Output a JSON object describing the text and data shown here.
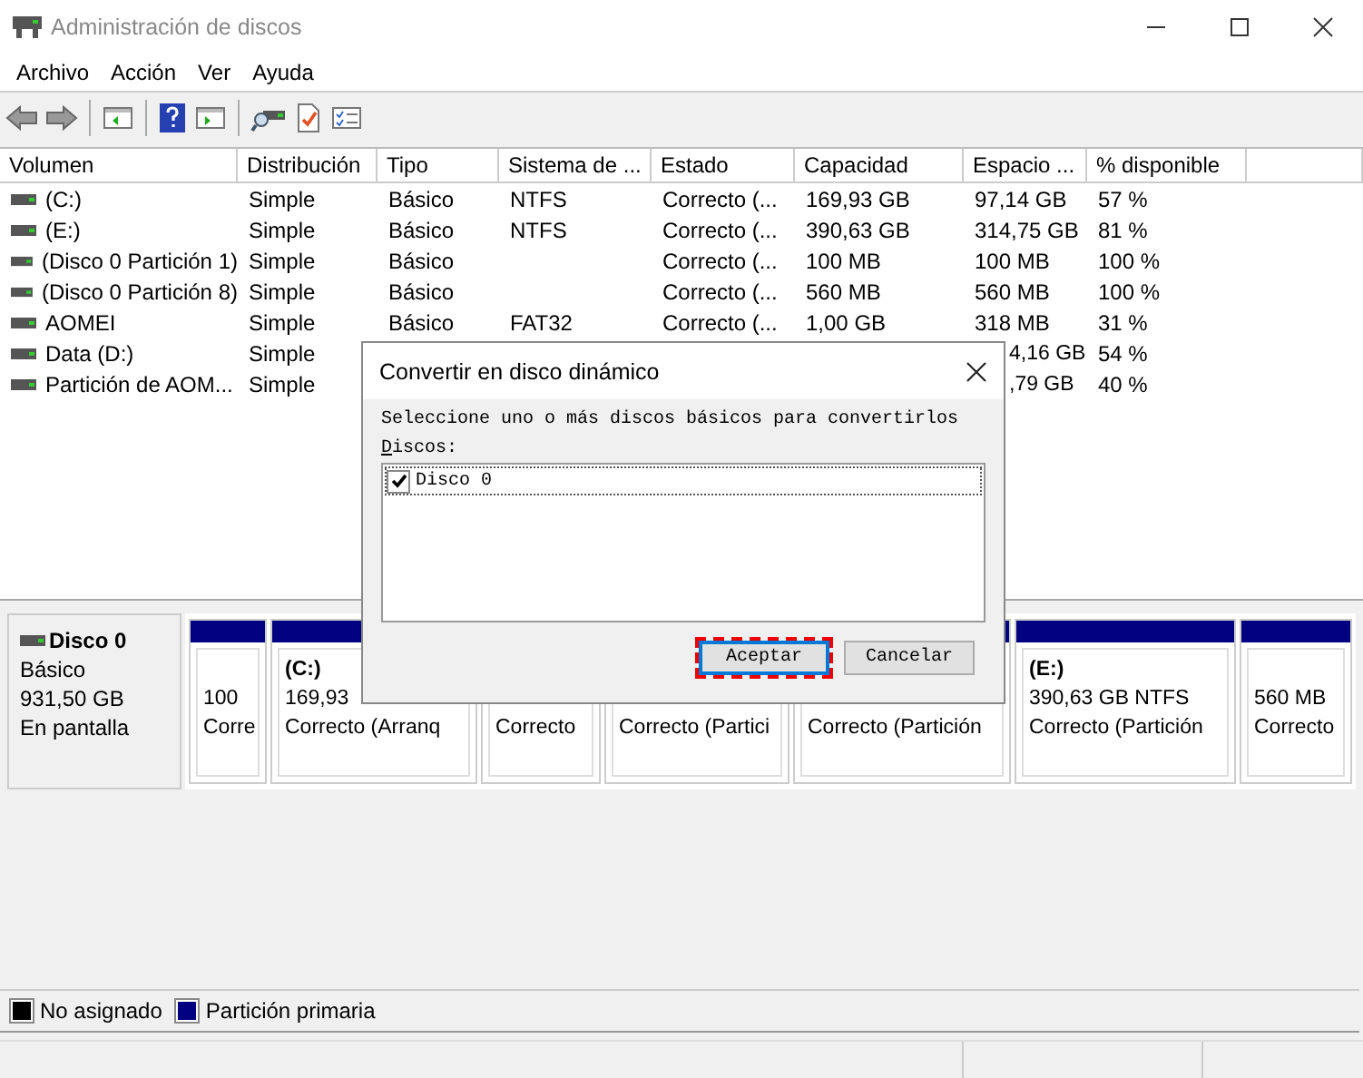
{
  "window": {
    "title": "Administración de discos"
  },
  "menu": [
    "Archivo",
    "Acción",
    "Ver",
    "Ayuda"
  ],
  "table": {
    "columns": [
      "Volumen",
      "Distribución",
      "Tipo",
      "Sistema de ...",
      "Estado",
      "Capacidad",
      "Espacio ...",
      "% disponible"
    ],
    "rows": [
      [
        "(C:)",
        "Simple",
        "Básico",
        "NTFS",
        "Correcto (...",
        "169,93 GB",
        "97,14 GB",
        "57 %"
      ],
      [
        "(E:)",
        "Simple",
        "Básico",
        "NTFS",
        "Correcto (...",
        "390,63 GB",
        "314,75 GB",
        "81 %"
      ],
      [
        "(Disco 0 Partición 1)",
        "Simple",
        "Básico",
        "",
        "Correcto (...",
        "100 MB",
        "100 MB",
        "100 %"
      ],
      [
        "(Disco 0 Partición 8)",
        "Simple",
        "Básico",
        "",
        "Correcto (...",
        "560 MB",
        "560 MB",
        "100 %"
      ],
      [
        "AOMEI",
        "Simple",
        "Básico",
        "FAT32",
        "Correcto (...",
        "1,00 GB",
        "318 MB",
        "31 %"
      ],
      [
        "Data (D:)",
        "Simple",
        null,
        null,
        null,
        null,
        "4,16 GB",
        "54 %"
      ],
      [
        "Partición de AOM...",
        "Simple",
        null,
        null,
        null,
        null,
        ",79 GB",
        "40 %"
      ]
    ]
  },
  "disk": {
    "name": "Disco 0",
    "type": "Básico",
    "size": "931,50 GB",
    "status": "En pantalla",
    "partitions": [
      {
        "detail": "100",
        "status": "Corre"
      },
      {
        "name": "(C:)",
        "detail": "169,93",
        "status": "Correcto (Arranq"
      },
      {
        "status": "Correcto"
      },
      {
        "status": "Correcto (Partici"
      },
      {
        "status": "Correcto (Partición"
      },
      {
        "name": "(E:)",
        "detail": "390,63 GB NTFS",
        "status": "Correcto (Partición"
      },
      {
        "detail": "560 MB",
        "status": "Correcto"
      }
    ]
  },
  "legend": [
    {
      "label": "No asignado",
      "color": "#000000"
    },
    {
      "label": "Partición primaria",
      "color": "#000080"
    }
  ],
  "dialog": {
    "title": "Convertir en disco dinámico",
    "prompt": "Seleccione uno o más discos básicos para convertirlos",
    "list_label": "Discos:",
    "disks": [
      {
        "label": "Disco 0",
        "checked": true
      }
    ],
    "buttons": [
      {
        "label": "Aceptar",
        "default": true
      },
      {
        "label": "Cancelar",
        "default": false
      }
    ]
  }
}
